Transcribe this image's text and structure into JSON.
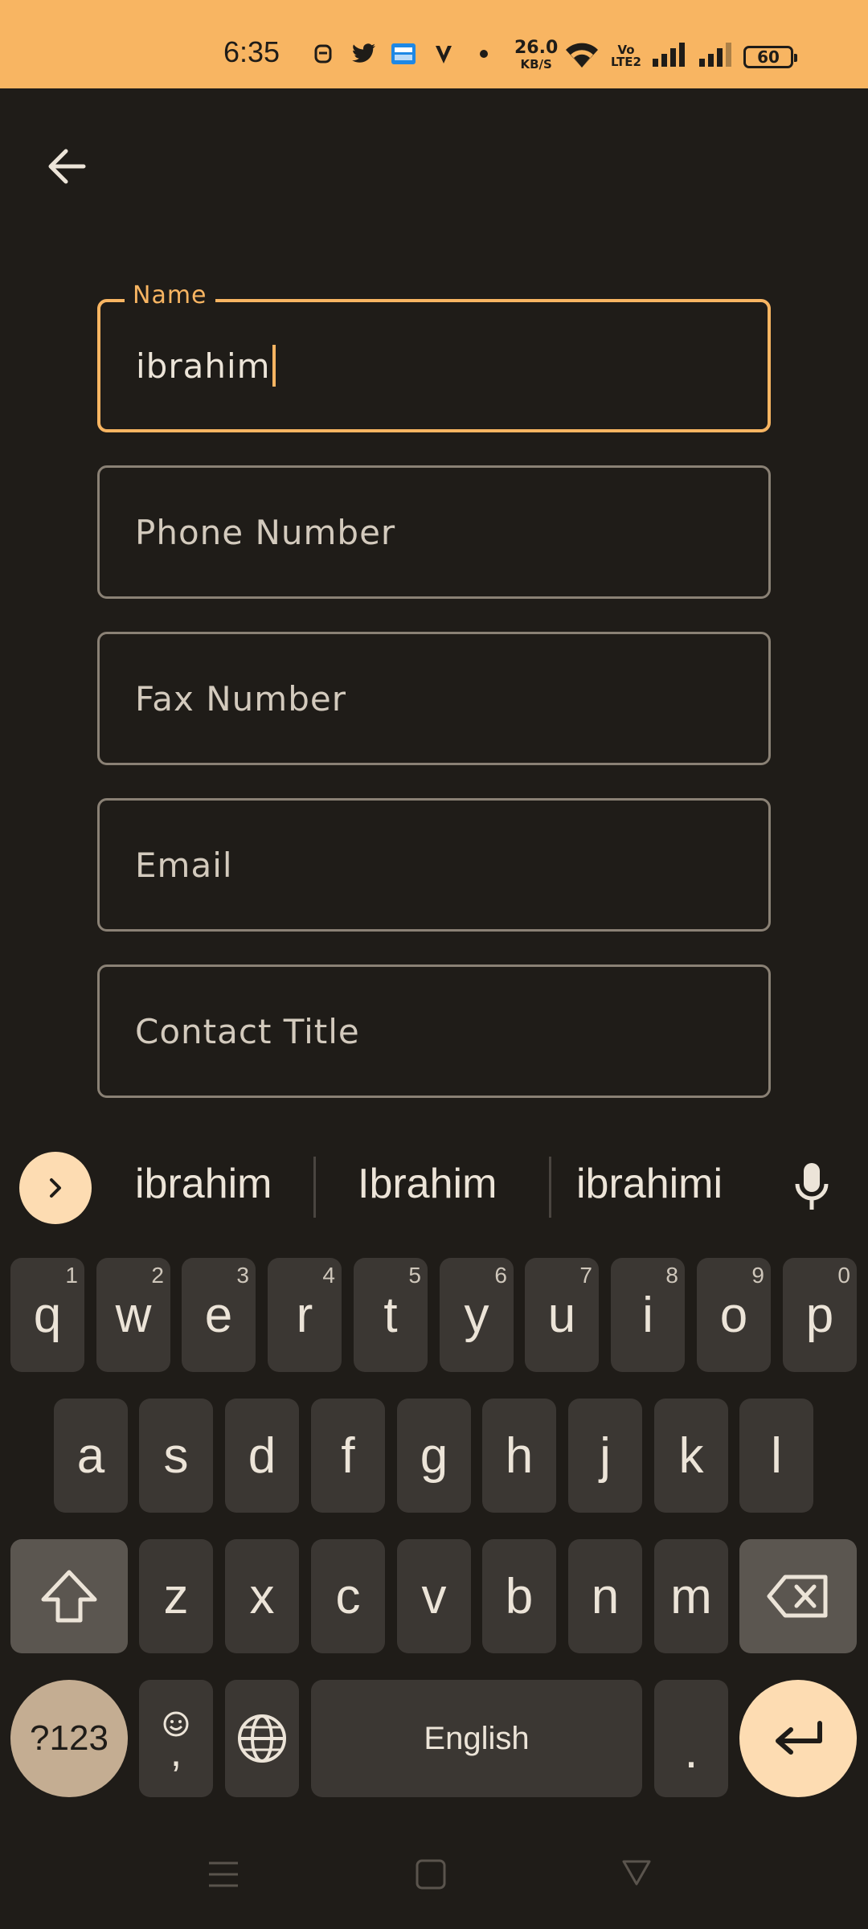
{
  "status_bar": {
    "time": "6:35",
    "net_speed": "26.0",
    "net_unit": "KB/S",
    "volte": "Vo",
    "lte": "LTE2",
    "battery": "60"
  },
  "form": {
    "name_label": "Name",
    "name_value": "ibrahim",
    "phone_placeholder": "Phone Number",
    "fax_placeholder": "Fax Number",
    "email_placeholder": "Email",
    "contact_title_placeholder": "Contact Title"
  },
  "keyboard": {
    "suggestions": [
      "ibrahim",
      "Ibrahim",
      "ibrahimi"
    ],
    "row1": [
      {
        "k": "q",
        "n": "1"
      },
      {
        "k": "w",
        "n": "2"
      },
      {
        "k": "e",
        "n": "3"
      },
      {
        "k": "r",
        "n": "4"
      },
      {
        "k": "t",
        "n": "5"
      },
      {
        "k": "y",
        "n": "6"
      },
      {
        "k": "u",
        "n": "7"
      },
      {
        "k": "i",
        "n": "8"
      },
      {
        "k": "o",
        "n": "9"
      },
      {
        "k": "p",
        "n": "0"
      }
    ],
    "row2": [
      "a",
      "s",
      "d",
      "f",
      "g",
      "h",
      "j",
      "k",
      "l"
    ],
    "row3": [
      "z",
      "x",
      "c",
      "v",
      "b",
      "n",
      "m"
    ],
    "symbols_label": "?123",
    "comma": ",",
    "space_label": "English",
    "period": "."
  },
  "colors": {
    "accent": "#f8b562",
    "background": "#1f1c18",
    "key": "#3b3733"
  }
}
